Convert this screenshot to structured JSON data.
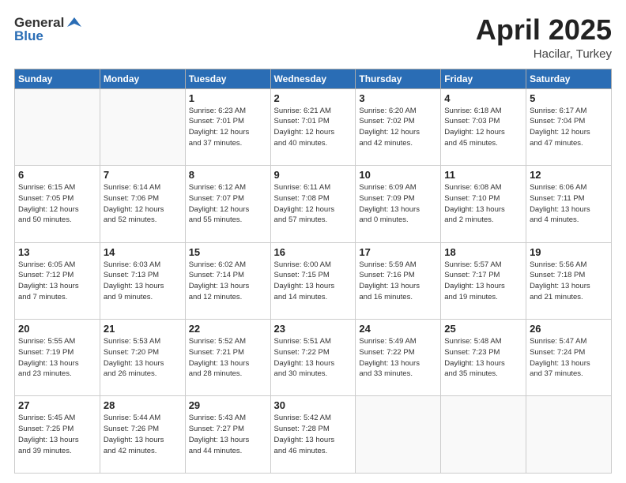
{
  "header": {
    "logo_general": "General",
    "logo_blue": "Blue",
    "month": "April 2025",
    "location": "Hacilar, Turkey"
  },
  "days_of_week": [
    "Sunday",
    "Monday",
    "Tuesday",
    "Wednesday",
    "Thursday",
    "Friday",
    "Saturday"
  ],
  "weeks": [
    [
      {
        "day": "",
        "info": ""
      },
      {
        "day": "",
        "info": ""
      },
      {
        "day": "1",
        "info": "Sunrise: 6:23 AM\nSunset: 7:01 PM\nDaylight: 12 hours\nand 37 minutes."
      },
      {
        "day": "2",
        "info": "Sunrise: 6:21 AM\nSunset: 7:01 PM\nDaylight: 12 hours\nand 40 minutes."
      },
      {
        "day": "3",
        "info": "Sunrise: 6:20 AM\nSunset: 7:02 PM\nDaylight: 12 hours\nand 42 minutes."
      },
      {
        "day": "4",
        "info": "Sunrise: 6:18 AM\nSunset: 7:03 PM\nDaylight: 12 hours\nand 45 minutes."
      },
      {
        "day": "5",
        "info": "Sunrise: 6:17 AM\nSunset: 7:04 PM\nDaylight: 12 hours\nand 47 minutes."
      }
    ],
    [
      {
        "day": "6",
        "info": "Sunrise: 6:15 AM\nSunset: 7:05 PM\nDaylight: 12 hours\nand 50 minutes."
      },
      {
        "day": "7",
        "info": "Sunrise: 6:14 AM\nSunset: 7:06 PM\nDaylight: 12 hours\nand 52 minutes."
      },
      {
        "day": "8",
        "info": "Sunrise: 6:12 AM\nSunset: 7:07 PM\nDaylight: 12 hours\nand 55 minutes."
      },
      {
        "day": "9",
        "info": "Sunrise: 6:11 AM\nSunset: 7:08 PM\nDaylight: 12 hours\nand 57 minutes."
      },
      {
        "day": "10",
        "info": "Sunrise: 6:09 AM\nSunset: 7:09 PM\nDaylight: 13 hours\nand 0 minutes."
      },
      {
        "day": "11",
        "info": "Sunrise: 6:08 AM\nSunset: 7:10 PM\nDaylight: 13 hours\nand 2 minutes."
      },
      {
        "day": "12",
        "info": "Sunrise: 6:06 AM\nSunset: 7:11 PM\nDaylight: 13 hours\nand 4 minutes."
      }
    ],
    [
      {
        "day": "13",
        "info": "Sunrise: 6:05 AM\nSunset: 7:12 PM\nDaylight: 13 hours\nand 7 minutes."
      },
      {
        "day": "14",
        "info": "Sunrise: 6:03 AM\nSunset: 7:13 PM\nDaylight: 13 hours\nand 9 minutes."
      },
      {
        "day": "15",
        "info": "Sunrise: 6:02 AM\nSunset: 7:14 PM\nDaylight: 13 hours\nand 12 minutes."
      },
      {
        "day": "16",
        "info": "Sunrise: 6:00 AM\nSunset: 7:15 PM\nDaylight: 13 hours\nand 14 minutes."
      },
      {
        "day": "17",
        "info": "Sunrise: 5:59 AM\nSunset: 7:16 PM\nDaylight: 13 hours\nand 16 minutes."
      },
      {
        "day": "18",
        "info": "Sunrise: 5:57 AM\nSunset: 7:17 PM\nDaylight: 13 hours\nand 19 minutes."
      },
      {
        "day": "19",
        "info": "Sunrise: 5:56 AM\nSunset: 7:18 PM\nDaylight: 13 hours\nand 21 minutes."
      }
    ],
    [
      {
        "day": "20",
        "info": "Sunrise: 5:55 AM\nSunset: 7:19 PM\nDaylight: 13 hours\nand 23 minutes."
      },
      {
        "day": "21",
        "info": "Sunrise: 5:53 AM\nSunset: 7:20 PM\nDaylight: 13 hours\nand 26 minutes."
      },
      {
        "day": "22",
        "info": "Sunrise: 5:52 AM\nSunset: 7:21 PM\nDaylight: 13 hours\nand 28 minutes."
      },
      {
        "day": "23",
        "info": "Sunrise: 5:51 AM\nSunset: 7:22 PM\nDaylight: 13 hours\nand 30 minutes."
      },
      {
        "day": "24",
        "info": "Sunrise: 5:49 AM\nSunset: 7:22 PM\nDaylight: 13 hours\nand 33 minutes."
      },
      {
        "day": "25",
        "info": "Sunrise: 5:48 AM\nSunset: 7:23 PM\nDaylight: 13 hours\nand 35 minutes."
      },
      {
        "day": "26",
        "info": "Sunrise: 5:47 AM\nSunset: 7:24 PM\nDaylight: 13 hours\nand 37 minutes."
      }
    ],
    [
      {
        "day": "27",
        "info": "Sunrise: 5:45 AM\nSunset: 7:25 PM\nDaylight: 13 hours\nand 39 minutes."
      },
      {
        "day": "28",
        "info": "Sunrise: 5:44 AM\nSunset: 7:26 PM\nDaylight: 13 hours\nand 42 minutes."
      },
      {
        "day": "29",
        "info": "Sunrise: 5:43 AM\nSunset: 7:27 PM\nDaylight: 13 hours\nand 44 minutes."
      },
      {
        "day": "30",
        "info": "Sunrise: 5:42 AM\nSunset: 7:28 PM\nDaylight: 13 hours\nand 46 minutes."
      },
      {
        "day": "",
        "info": ""
      },
      {
        "day": "",
        "info": ""
      },
      {
        "day": "",
        "info": ""
      }
    ]
  ]
}
